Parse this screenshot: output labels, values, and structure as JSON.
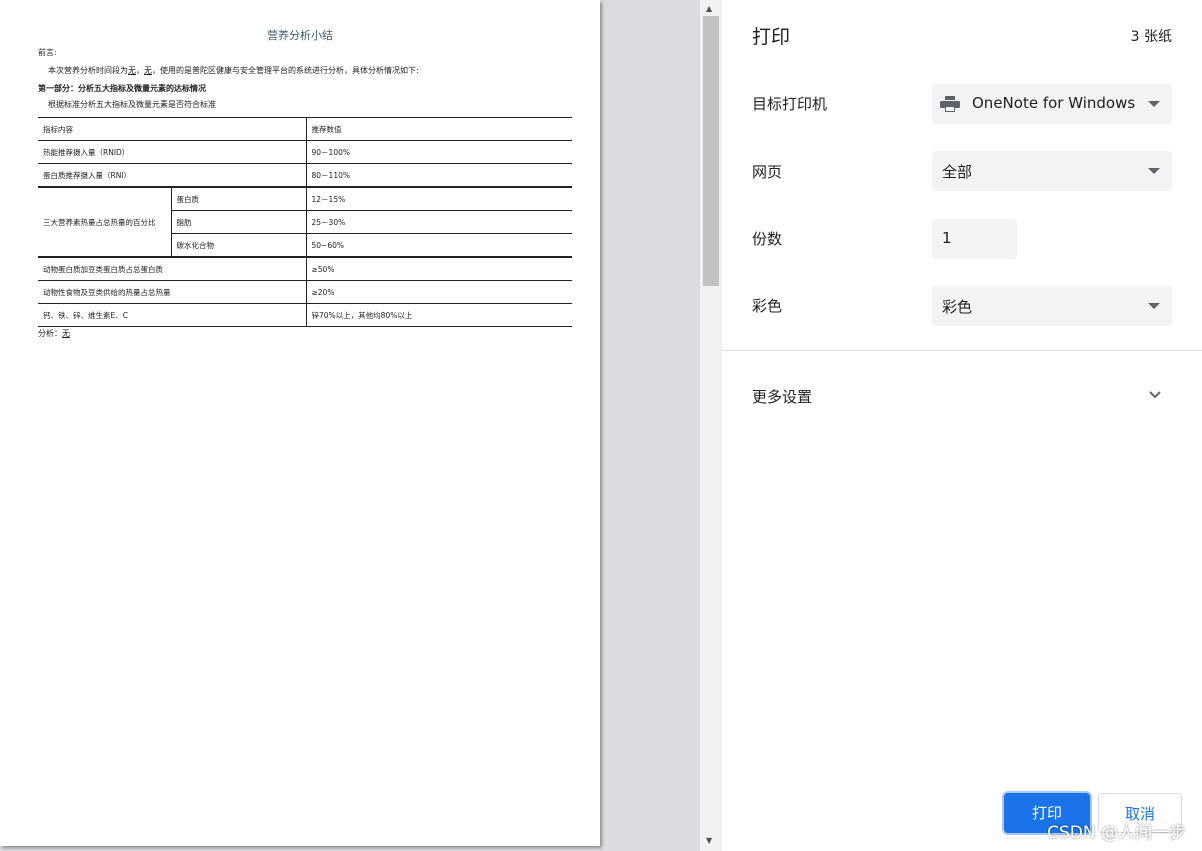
{
  "document": {
    "title": "营养分析小结",
    "preface_label": "前言:",
    "intro_prefix": "本次营养分析时间段为",
    "intro_val1": "无",
    "intro_sep": "，",
    "intro_val2": "无",
    "intro_suffix": "，使用的是普陀区健康与安全管理平台的系统进行分析，具体分析情况如下:",
    "section1_heading": "第一部分：分析五大指标及微量元素的达标情况",
    "section1_sub": "根据标准分析五大指标及微量元素是否符合标准",
    "table": {
      "header": [
        "指标内容",
        "推荐数值"
      ],
      "rows": [
        [
          "热能推荐摄入量（RNID）",
          "90－100%"
        ],
        [
          "蛋白质推荐摄入量（RNI）",
          "80－110%"
        ]
      ],
      "macro_group_label": "三大营养素热量占总热量的百分比",
      "macro_rows": [
        [
          "蛋白质",
          "12－15%"
        ],
        [
          "脂肪",
          "25－30%"
        ],
        [
          "碳水化合物",
          "50~60%"
        ]
      ],
      "tail_rows": [
        [
          "动物蛋白质加豆类蛋白质占总蛋白质",
          "≥50%"
        ],
        [
          "动物性食物及豆类供给的热量占总热量",
          "≥20%"
        ],
        [
          "钙、铁、锌、维生素E、C",
          "锌70%以上，其他均80%以上"
        ]
      ]
    },
    "analysis_label": "分析：",
    "analysis_value": "无"
  },
  "print_panel": {
    "title": "打印",
    "sheet_count": "3 张纸",
    "destination_label": "目标打印机",
    "destination_value": "OneNote for Windows",
    "pages_label": "网页",
    "pages_value": "全部",
    "copies_label": "份数",
    "copies_value": "1",
    "color_label": "彩色",
    "color_value": "彩色",
    "more_settings_label": "更多设置",
    "print_button": "打印",
    "cancel_button": "取消"
  },
  "watermark": "CSDN @人间一步",
  "colors": {
    "primary": "#1a73e8",
    "panel_bg": "#ffffff",
    "preview_bg": "#dadce0",
    "control_bg": "#f1f3f4"
  }
}
